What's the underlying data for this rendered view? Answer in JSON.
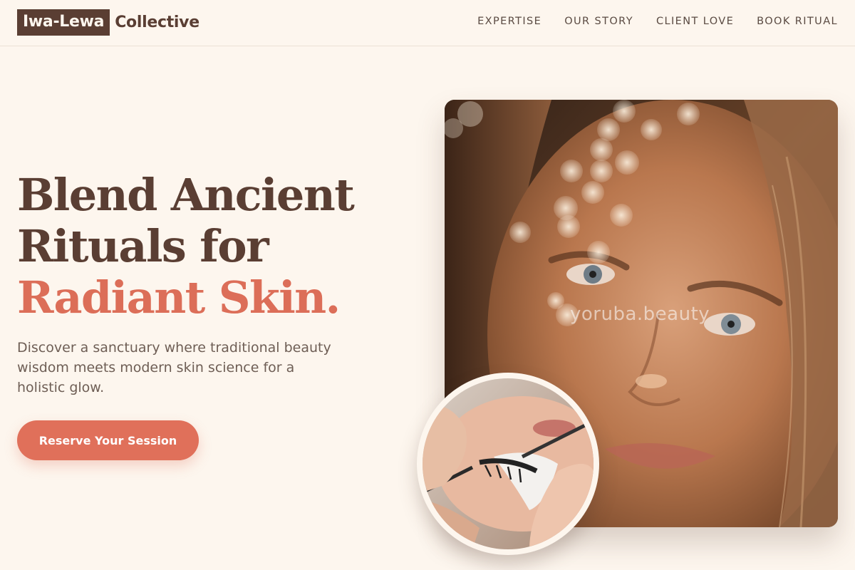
{
  "brand": {
    "mark": "Iwa-Lewa",
    "name": "Collective"
  },
  "nav": [
    {
      "label": "EXPERTISE"
    },
    {
      "label": "OUR STORY"
    },
    {
      "label": "CLIENT LOVE"
    },
    {
      "label": "BOOK RITUAL"
    }
  ],
  "hero": {
    "title_line1": "Blend Ancient",
    "title_line2": "Rituals for",
    "title_accent": "Radiant Skin.",
    "description": "Discover a sanctuary where traditional beauty wisdom meets modern skin science for a holistic glow.",
    "cta_label": "Reserve Your Session"
  },
  "main_image": {
    "watermark": "yoruba.beauty"
  },
  "colors": {
    "background": "#fdf6ee",
    "brown": "#5a3e33",
    "accent": "#dc6e58",
    "cta": "#e0705a"
  }
}
